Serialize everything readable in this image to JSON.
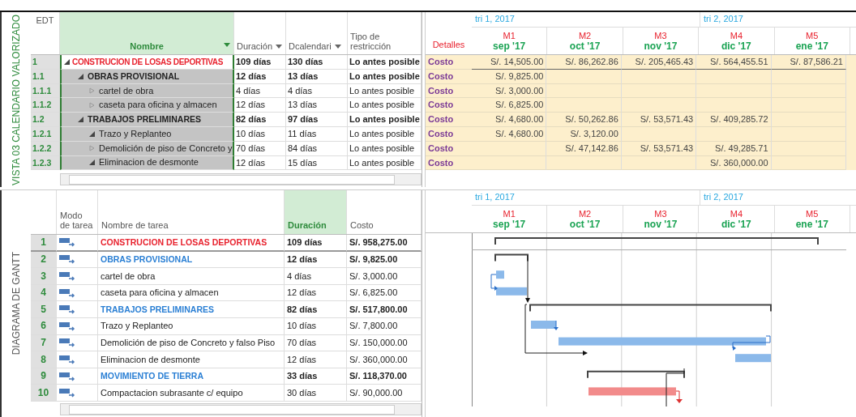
{
  "calendar_view": {
    "side_label": "VISTA 03 CALENDARIO VALORIZADO",
    "columns": [
      {
        "label": "EDT",
        "highlighted": false,
        "dropdown": false
      },
      {
        "label": "Nombre",
        "highlighted": true,
        "dropdown": true
      },
      {
        "label": "Duración",
        "highlighted": false,
        "dropdown": true
      },
      {
        "label": "Dcalendari",
        "highlighted": false,
        "dropdown": true
      },
      {
        "label": "Tipo de restricción",
        "highlighted": false,
        "dropdown": false
      }
    ],
    "details_header": "Detalles",
    "timescale": {
      "quarters": [
        "tri 1, 2017",
        "tri 2, 2017"
      ],
      "months": [
        {
          "code": "M1",
          "label": "sep '17"
        },
        {
          "code": "M2",
          "label": "oct '17"
        },
        {
          "code": "M3",
          "label": "nov '17"
        },
        {
          "code": "M4",
          "label": "dic '17"
        },
        {
          "code": "M5",
          "label": "ene '17"
        }
      ]
    },
    "tasks": [
      {
        "edt": "1",
        "name": "CONSTRUCION DE LOSAS DEPORTIVAS",
        "kind": "project",
        "expanded": true,
        "selected": true,
        "duration": "109 días",
        "calendar_days": "130 días",
        "constraint": "Lo antes posible",
        "detail": "Costo",
        "costs": [
          {
            "value": "S/. 14,505.00"
          },
          {
            "value": "S/. 86,262.86"
          },
          {
            "value": "S/. 205,465.43"
          },
          {
            "value": "S/. 564,455.51"
          },
          {
            "value": "S/. 87,586.21"
          }
        ],
        "children": [
          {
            "edt": "1.1",
            "name": "OBRAS PROVISIONAL",
            "kind": "summary",
            "expanded": true,
            "selected": false,
            "duration": "12 días",
            "calendar_days": "13 días",
            "constraint": "Lo antes posible",
            "detail": "Costo",
            "costs": [
              {
                "value": "S/. 9,825.00"
              },
              {
                "empty": true
              },
              {
                "empty": true
              },
              {
                "empty": true
              },
              {
                "empty": true
              }
            ],
            "children": [
              {
                "edt": "1.1.1",
                "name": "cartel de obra",
                "kind": "task",
                "expanded": false,
                "selected": false,
                "duration": "4 días",
                "calendar_days": "4 días",
                "constraint": "Lo antes posible",
                "detail": "Costo",
                "costs": [
                  {
                    "value": "S/. 3,000.00"
                  },
                  {
                    "empty": true
                  },
                  {
                    "empty": true
                  },
                  {
                    "empty": true
                  },
                  {
                    "empty": true
                  }
                ]
              },
              {
                "edt": "1.1.2",
                "name": "caseta para oficina y almacen",
                "kind": "task",
                "expanded": false,
                "selected": false,
                "duration": "12 días",
                "calendar_days": "13 días",
                "constraint": "Lo antes posible",
                "detail": "Costo",
                "costs": [
                  {
                    "value": "S/. 6,825.00"
                  },
                  {
                    "empty": true
                  },
                  {
                    "empty": true
                  },
                  {
                    "empty": true
                  },
                  {
                    "empty": true
                  }
                ]
              }
            ]
          },
          {
            "edt": "1.2",
            "name": "TRABAJOS PRELIMINARES",
            "kind": "summary",
            "expanded": true,
            "selected": false,
            "duration": "82 días",
            "calendar_days": "97 días",
            "constraint": "Lo antes posible",
            "detail": "Costo",
            "costs": [
              {
                "value": "S/. 4,680.00"
              },
              {
                "value": "S/. 50,262.86"
              },
              {
                "value": "S/. 53,571.43"
              },
              {
                "value": "S/. 409,285.72"
              },
              {
                "empty": true
              }
            ],
            "children": [
              {
                "edt": "1.2.1",
                "name": "Trazo y Replanteo",
                "kind": "task",
                "expanded": true,
                "selected": false,
                "duration": "10 días",
                "calendar_days": "11 días",
                "constraint": "Lo antes posible",
                "detail": "Costo",
                "costs": [
                  {
                    "value": "S/. 4,680.00"
                  },
                  {
                    "value": "S/. 3,120.00"
                  },
                  {
                    "empty": true
                  },
                  {
                    "empty": true
                  },
                  {
                    "empty": true
                  }
                ]
              },
              {
                "edt": "1.2.2",
                "name": "Demolición de piso de Concreto y",
                "kind": "task",
                "expanded": false,
                "selected": false,
                "duration": "70 días",
                "calendar_days": "84 días",
                "constraint": "Lo antes posible",
                "detail": "Costo",
                "costs": [
                  {
                    "empty": true
                  },
                  {
                    "value": "S/. 47,142.86"
                  },
                  {
                    "value": "S/. 53,571.43"
                  },
                  {
                    "value": "S/. 49,285.71"
                  },
                  {
                    "empty": true
                  }
                ]
              },
              {
                "edt": "1.2.3",
                "name": "Eliminacion de desmonte",
                "kind": "task",
                "expanded": true,
                "selected": false,
                "duration": "12 días",
                "calendar_days": "15 días",
                "constraint": "Lo antes posible",
                "detail": "Costo",
                "costs": [
                  {
                    "empty": true
                  },
                  {
                    "empty": true
                  },
                  {
                    "empty": true
                  },
                  {
                    "value": "S/. 360,000.00"
                  },
                  {
                    "empty": true
                  }
                ]
              }
            ]
          }
        ]
      }
    ]
  },
  "gantt_view": {
    "side_label": "DIAGRAMA DE GANTT",
    "columns": [
      {
        "label": "Modo de tarea",
        "highlighted": false
      },
      {
        "label": "Nombre de tarea",
        "highlighted": false
      },
      {
        "label": "Duración",
        "highlighted": true
      },
      {
        "label": "Costo",
        "highlighted": false
      }
    ],
    "timescale": {
      "quarters": [
        "tri 1, 2017",
        "tri 2, 2017"
      ],
      "months": [
        {
          "code": "M1",
          "label": "sep '17"
        },
        {
          "code": "M2",
          "label": "oct '17"
        },
        {
          "code": "M3",
          "label": "nov '17"
        },
        {
          "code": "M4",
          "label": "dic '17"
        },
        {
          "code": "M5",
          "label": "ene '17"
        }
      ]
    },
    "rows": [
      {
        "id": "1",
        "name": "CONSTRUCION DE LOSAS DEPORTIVAS",
        "kind": "project",
        "duration": "109 días",
        "cost": "S/. 958,275.00"
      },
      {
        "id": "2",
        "name": "OBRAS PROVISIONAL",
        "kind": "summary",
        "duration": "12 días",
        "cost": "S/. 9,825.00"
      },
      {
        "id": "3",
        "name": "cartel de obra",
        "kind": "task",
        "duration": "4 días",
        "cost": "S/. 3,000.00"
      },
      {
        "id": "4",
        "name": "caseta para oficina y almacen",
        "kind": "task",
        "duration": "12 días",
        "cost": "S/. 6,825.00"
      },
      {
        "id": "5",
        "name": "TRABAJOS PRELIMINARES",
        "kind": "summary",
        "duration": "82 días",
        "cost": "S/. 517,800.00"
      },
      {
        "id": "6",
        "name": "Trazo y Replanteo",
        "kind": "task",
        "duration": "10 días",
        "cost": "S/. 7,800.00"
      },
      {
        "id": "7",
        "name": "Demolición de piso de Concreto y falso Piso",
        "kind": "task",
        "duration": "70 días",
        "cost": "S/. 150,000.00"
      },
      {
        "id": "8",
        "name": "Eliminacion de desmonte",
        "kind": "task",
        "duration": "12 días",
        "cost": "S/. 360,000.00"
      },
      {
        "id": "9",
        "name": "MOVIMIENTO DE TIERRA",
        "kind": "summary",
        "duration": "33 días",
        "cost": "S/. 118,370.00"
      },
      {
        "id": "10",
        "name": "Compactacion subrasante c/ equipo",
        "kind": "task",
        "duration": "30 días",
        "cost": "S/. 90,000.00"
      }
    ]
  }
}
